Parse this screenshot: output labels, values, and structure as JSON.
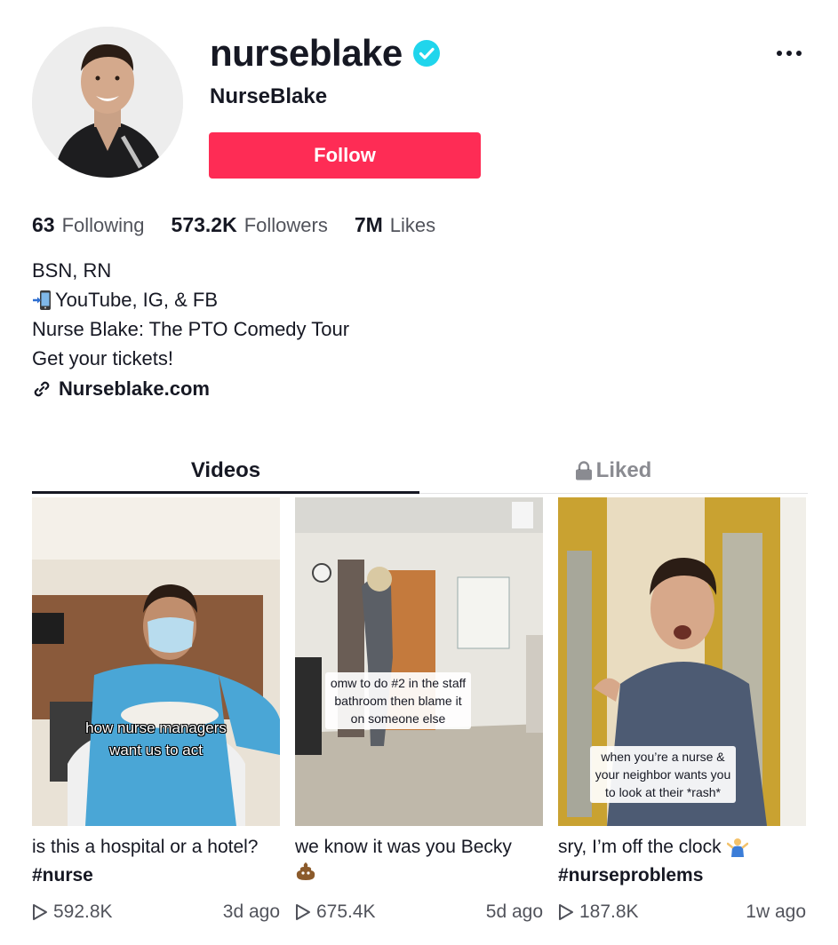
{
  "profile": {
    "username": "nurseblake",
    "display_name": "NurseBlake",
    "verified_icon": "verified-check-icon",
    "follow_label": "Follow",
    "more_icon": "more-dots-icon"
  },
  "stats": [
    {
      "value": "63",
      "label": "Following"
    },
    {
      "value": "573.2K",
      "label": "Followers"
    },
    {
      "value": "7M",
      "label": "Likes"
    }
  ],
  "bio": {
    "line1": "BSN, RN",
    "line2": "YouTube, IG, & FB",
    "line3": "Nurse Blake: The PTO Comedy Tour",
    "line4": "Get your tickets!",
    "link": "Nurseblake.com"
  },
  "tabs": {
    "videos": "Videos",
    "liked": "Liked"
  },
  "videos": [
    {
      "overlay_line1": "how nurse managers",
      "overlay_line2": "want us to act",
      "caption": "is this a hospital or a hotel?",
      "hashtag": "#nurse",
      "views": "592.8K",
      "age": "3d ago"
    },
    {
      "overlay_line1": "omw to do #2 in the staff",
      "overlay_line2": "bathroom then blame it",
      "overlay_line3": "on someone else",
      "caption": "we know it was you Becky",
      "hashtag": "",
      "views": "675.4K",
      "age": "5d ago"
    },
    {
      "overlay_line1": "when you’re a nurse &",
      "overlay_line2": "your neighbor wants you",
      "overlay_line3": "to look at their *rash*",
      "caption": "sry, I’m off the clock",
      "hashtag": "#nurseproblems",
      "views": "187.8K",
      "age": "1w ago"
    }
  ],
  "colors": {
    "follow": "#fe2c55",
    "verified": "#20d5ec",
    "text": "#161823"
  }
}
